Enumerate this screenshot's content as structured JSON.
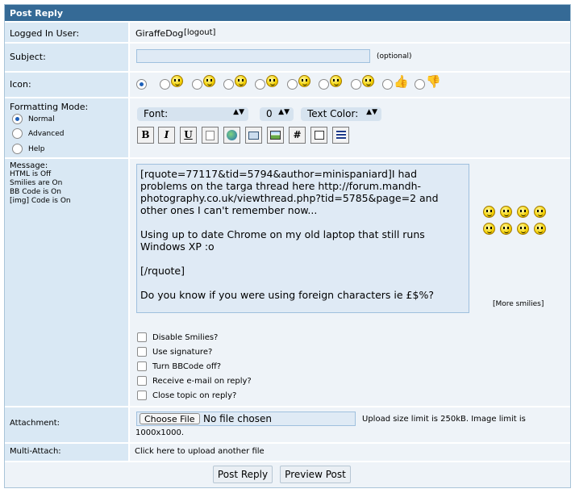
{
  "header": {
    "title": "Post Reply"
  },
  "logged_in": {
    "label": "Logged In User:",
    "username": "GiraffeDog",
    "logout": "[logout]"
  },
  "subject": {
    "label": "Subject:",
    "value": "",
    "optional_note": "(optional)"
  },
  "icon": {
    "label": "Icon:",
    "icons": [
      "none",
      "smile-icon",
      "frown-icon",
      "grin-icon",
      "wink-icon",
      "cool-icon",
      "sleepy-icon",
      "surprised-icon",
      "thumbs-up-icon",
      "thumbs-down-icon"
    ]
  },
  "formatting": {
    "label": "Formatting Mode:",
    "modes": [
      "Normal",
      "Advanced",
      "Help"
    ],
    "selected": "Normal",
    "font_select": "Font:",
    "size_select": "0",
    "color_select": "Text Color:",
    "toolbar": [
      "B",
      "I",
      "U",
      "",
      "",
      "",
      "",
      "#",
      "",
      ""
    ]
  },
  "message": {
    "label": "Message:",
    "html_status": "HTML is Off",
    "smilies_status": "Smilies are On",
    "bbcode_status": "BB Code is On",
    "img_status": "[img] Code is On",
    "body": "[rquote=77117&tid=5794&author=minispaniard]I had problems on the targa thread here http://forum.mandh-photography.co.uk/viewthread.php?tid=5785&page=2 and other ones I can't remember now...\n\nUsing up to date Chrome on my old laptop that still runs Windows XP :o\n\n[/rquote]\n\nDo you know if you were using foreign characters ie £$%?",
    "more_smilies": "[More smilies]"
  },
  "options": [
    "Disable Smilies?",
    "Use signature?",
    "Turn BBCode off?",
    "Receive e-mail on reply?",
    "Close topic on reply?"
  ],
  "attachment": {
    "label": "Attachment:",
    "choose_button": "Choose File",
    "file_status": "No file chosen",
    "limit_line1": "Upload size limit is 250kB. Image limit is",
    "limit_line2": "1000x1000."
  },
  "multi_attach": {
    "label": "Multi-Attach:",
    "link": "Click here to upload another file"
  },
  "actions": {
    "post_reply": "Post Reply",
    "preview_post": "Preview Post"
  }
}
